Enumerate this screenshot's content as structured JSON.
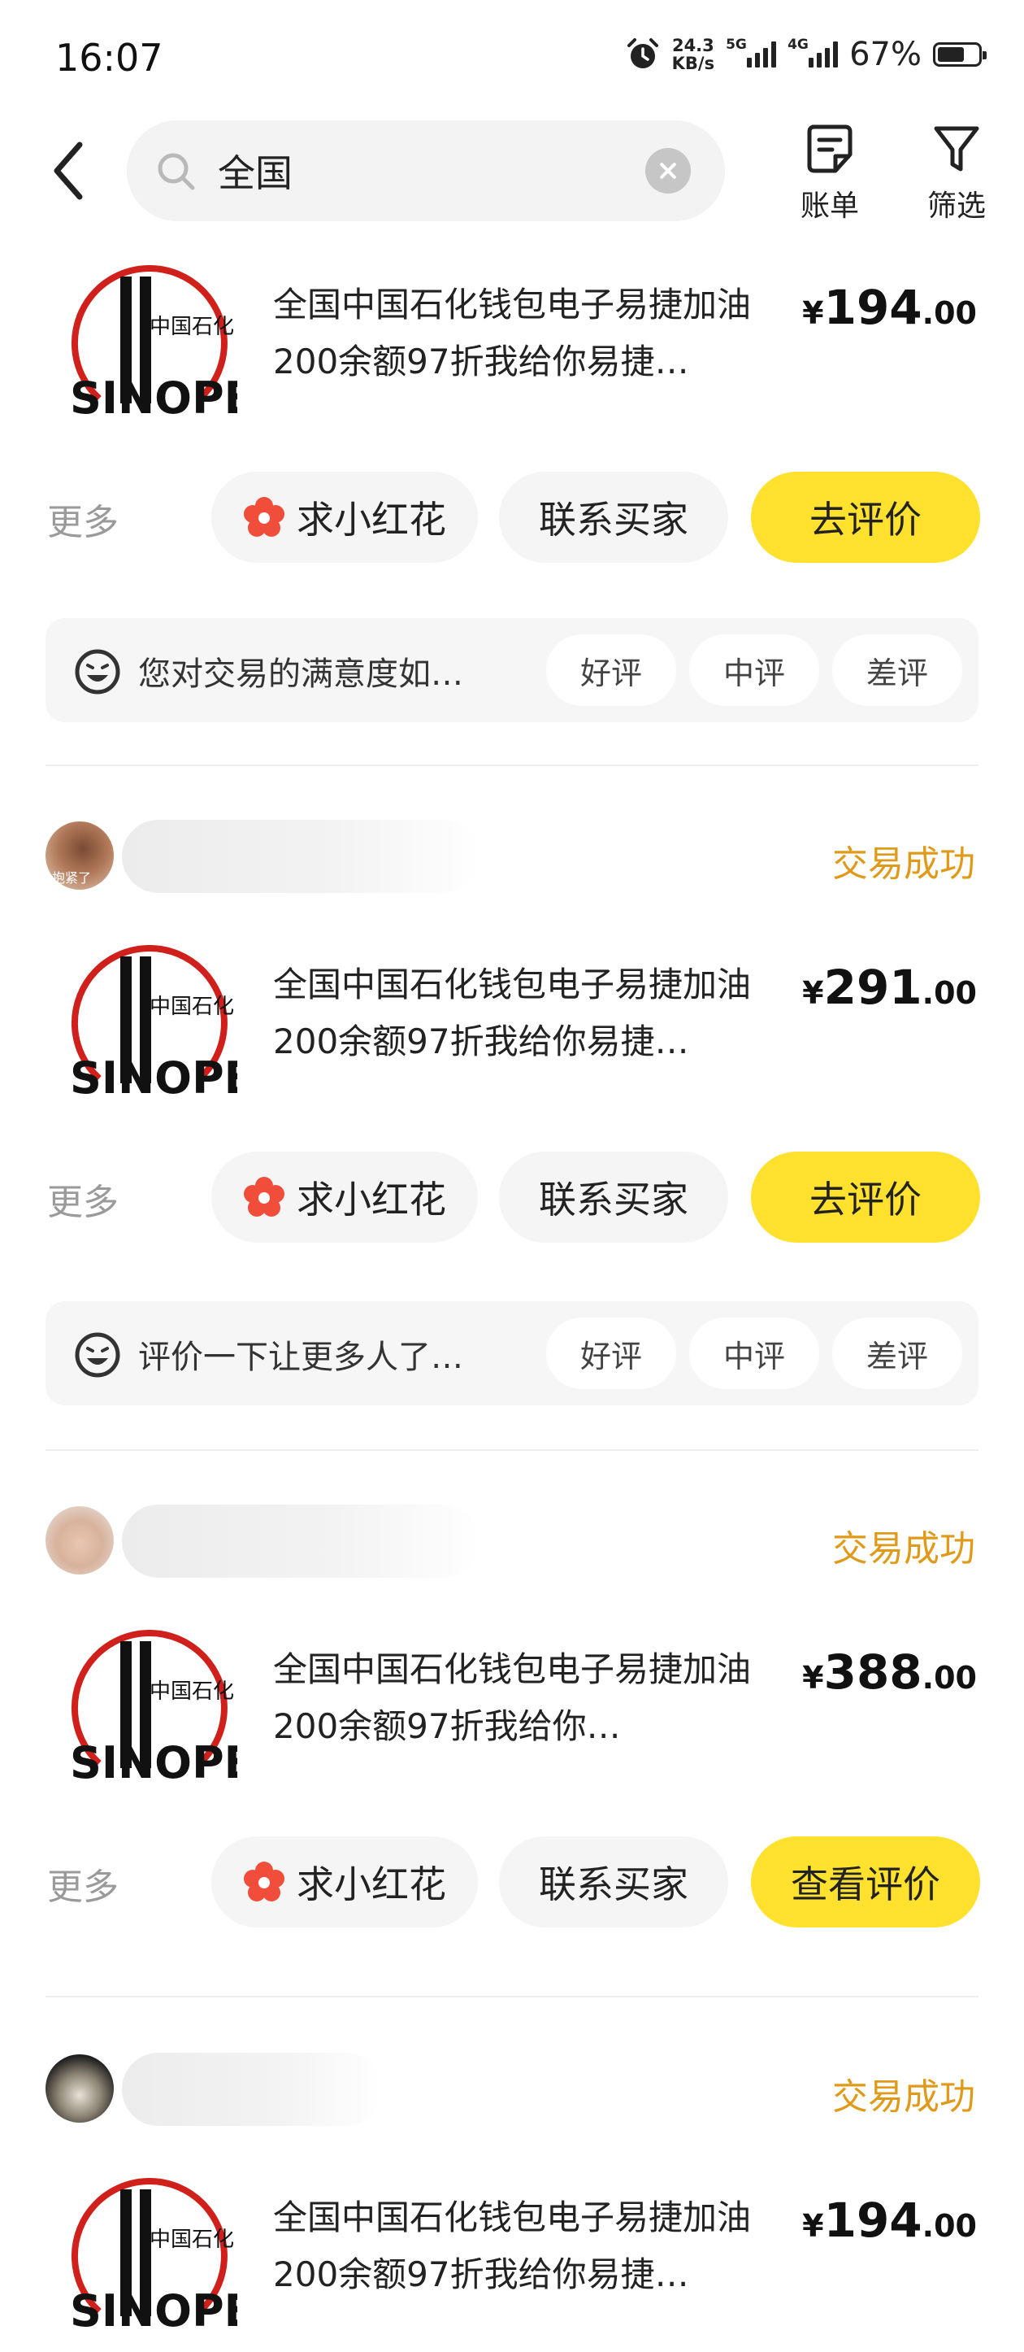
{
  "status_bar": {
    "time": "16:07",
    "net_speed_value": "24.3",
    "net_speed_unit": "KB/s",
    "sim1_label": "5G",
    "sim2_label": "4G",
    "battery_percent": "67%",
    "battery_level": 0.67,
    "icons": [
      "alarm-icon",
      "signal-icon",
      "battery-icon"
    ]
  },
  "header": {
    "back_icon": "chevron-left-icon",
    "search_value": "全国",
    "search_icon": "search-icon",
    "clear_icon": "clear-icon",
    "bill_label": "账单",
    "filter_label": "筛选"
  },
  "orders": [
    {
      "status": "",
      "title": "全国中国石化钱包电子易捷加油200余额97折我给你易捷…",
      "price_currency": "¥",
      "price_int": "194",
      "price_dec": ".00",
      "more_label": "更多",
      "flower_label": "求小红花",
      "contact_label": "联系买家",
      "review_label": "去评价",
      "rating_prompt": "您对交易的满意度如…",
      "rating_good": "好评",
      "rating_mid": "中评",
      "rating_bad": "差评"
    },
    {
      "status": "交易成功",
      "avatar_caption": "抱紧了",
      "title": "全国中国石化钱包电子易捷加油200余额97折我给你易捷…",
      "price_currency": "¥",
      "price_int": "291",
      "price_dec": ".00",
      "more_label": "更多",
      "flower_label": "求小红花",
      "contact_label": "联系买家",
      "review_label": "去评价",
      "rating_prompt": "评价一下让更多人了…",
      "rating_good": "好评",
      "rating_mid": "中评",
      "rating_bad": "差评"
    },
    {
      "status": "交易成功",
      "title": "全国中国石化钱包电子易捷加油200余额97折我给你…",
      "price_currency": "¥",
      "price_int": "388",
      "price_dec": ".00",
      "more_label": "更多",
      "flower_label": "求小红花",
      "contact_label": "联系买家",
      "review_label": "查看评价"
    },
    {
      "status": "交易成功",
      "title": "全国中国石化钱包电子易捷加油200余额97折我给你易捷…",
      "price_currency": "¥",
      "price_int": "194",
      "price_dec": ".00"
    }
  ],
  "logo": {
    "brand_text": "SINOPEC",
    "chinese_text": "中国石化",
    "ring_color": "#d0201c"
  },
  "colors": {
    "accent_yellow": "#ffe12e",
    "status_orange": "#e09a1a",
    "flower_red": "#f04e3a"
  }
}
